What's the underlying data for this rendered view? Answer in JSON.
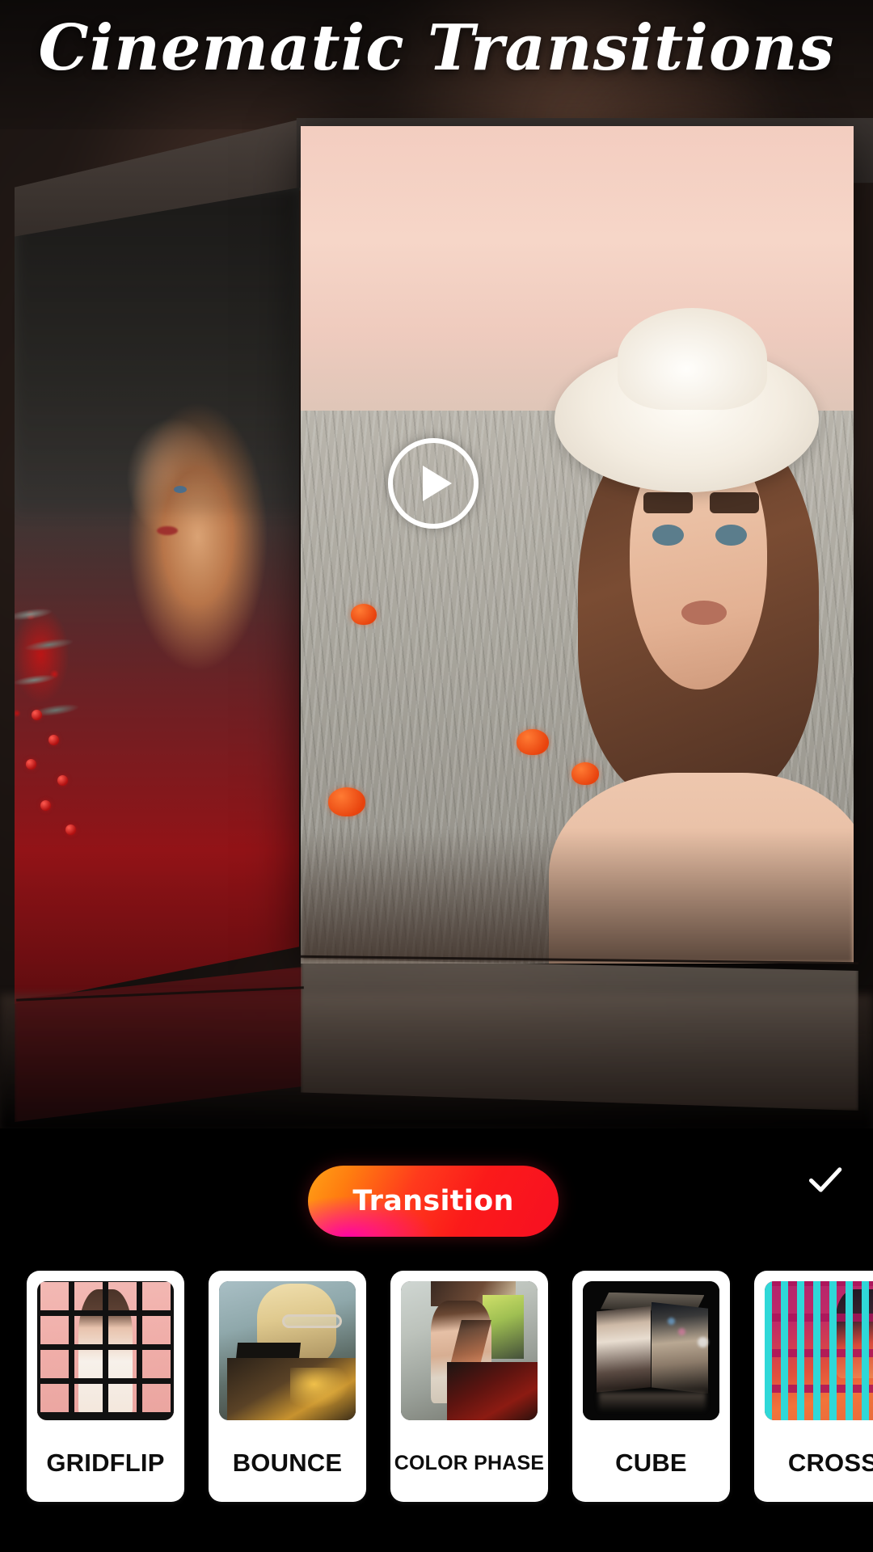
{
  "app": {
    "title": "Cinematic Transitions",
    "background_color": "#000000"
  },
  "preview": {
    "name": "cube-transition-preview",
    "play_icon": "play-icon",
    "description": "3D cube transition showing two photos on adjacent cube faces"
  },
  "toolbar": {
    "transition_label": "Transition",
    "transition_gradient_start": "#ffa216",
    "transition_gradient_mid": "#ff1aa0",
    "transition_gradient_end": "#f70f22",
    "confirm_icon": "check-icon",
    "confirm_color": "#ffffff"
  },
  "transitions": {
    "items": [
      {
        "label": "GRIDFLIP",
        "thumb": "gridflip-thumb",
        "label_size": "large"
      },
      {
        "label": "BOUNCE",
        "thumb": "bounce-thumb",
        "label_size": "large"
      },
      {
        "label": "COLOR PHASE",
        "thumb": "color-phase-thumb",
        "label_size": "small"
      },
      {
        "label": "CUBE",
        "thumb": "cube-thumb",
        "label_size": "large"
      },
      {
        "label": "CROSS",
        "thumb": "cross-thumb",
        "label_size": "large"
      }
    ]
  }
}
